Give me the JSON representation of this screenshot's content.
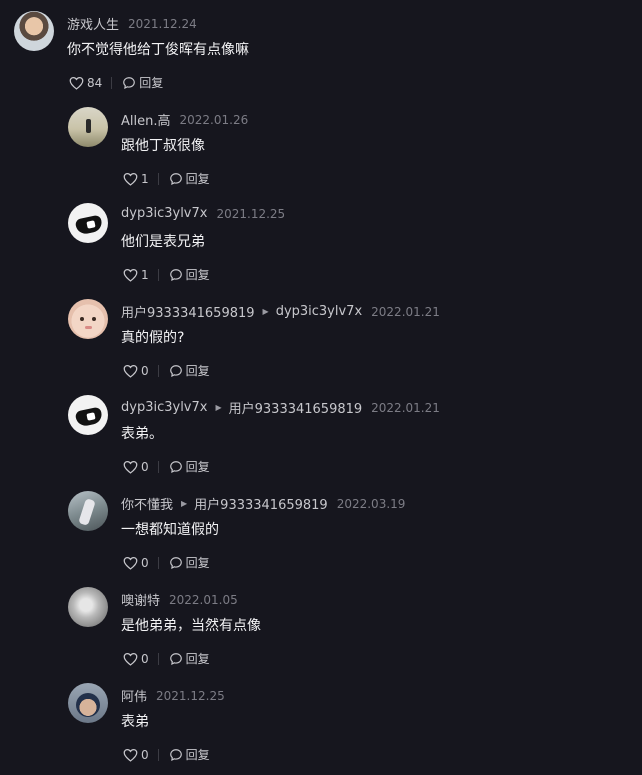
{
  "comments": [
    {
      "username": "游戏人生",
      "date": "2021.12.24",
      "text": "你不觉得他给丁俊晖有点像嘛",
      "likes": "84",
      "reply_label": "回复",
      "avatar_icon": "person-photo-avatar"
    },
    {
      "username": "Allen.高",
      "date": "2022.01.26",
      "text": "跟他丁叔很像",
      "likes": "1",
      "reply_label": "回复",
      "avatar_icon": "silhouette-photo-avatar"
    },
    {
      "username": "dyp3ic3ylv7x",
      "date": "2021.12.25",
      "text": "他们是表兄弟",
      "likes": "1",
      "reply_label": "回复",
      "avatar_icon": "cartoon-avatar"
    },
    {
      "username": "用户9333341659819",
      "reply_to": "dyp3ic3ylv7x",
      "date": "2022.01.21",
      "text": "真的假的?",
      "likes": "0",
      "reply_label": "回复",
      "avatar_icon": "baby-photo-avatar"
    },
    {
      "username": "dyp3ic3ylv7x",
      "reply_to": "用户9333341659819",
      "date": "2022.01.21",
      "text": "表弟。",
      "likes": "0",
      "reply_label": "回复",
      "avatar_icon": "cartoon-avatar"
    },
    {
      "username": "你不懂我",
      "reply_to": "用户9333341659819",
      "date": "2022.03.19",
      "text": "一想都知道假的",
      "likes": "0",
      "reply_label": "回复",
      "avatar_icon": "landscape-photo-avatar"
    },
    {
      "username": "噢谢特",
      "date": "2022.01.05",
      "text": "是他弟弟，当然有点像",
      "likes": "0",
      "reply_label": "回复",
      "avatar_icon": "moon-photo-avatar"
    },
    {
      "username": "阿伟",
      "date": "2021.12.25",
      "text": "表弟",
      "likes": "0",
      "reply_label": "回复",
      "avatar_icon": "boy-photo-avatar"
    }
  ],
  "colors": {
    "background": "#16161e",
    "username": "#c7c7cc",
    "date": "#7c7c85",
    "text": "#f2f2f4"
  }
}
